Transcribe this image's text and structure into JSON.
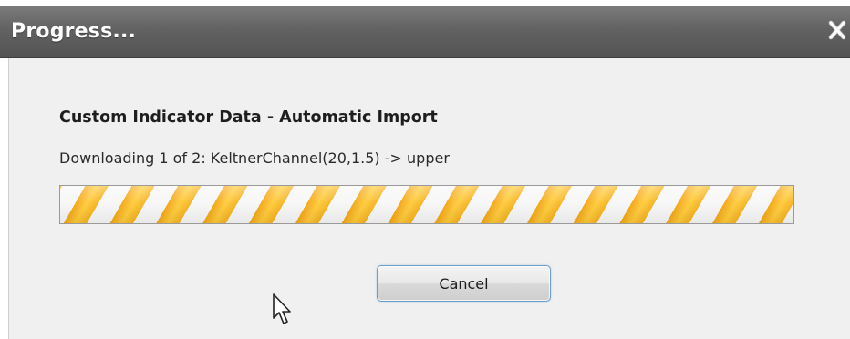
{
  "window": {
    "title": "Progress...",
    "close_icon": "close-icon"
  },
  "dialog": {
    "heading": "Custom Indicator Data - Automatic Import",
    "status": "Downloading 1 of 2: KeltnerChannel(20,1.5) -> upper",
    "progress": {
      "fraction": 1.0,
      "style": "striped-indeterminate"
    },
    "cancel_label": "Cancel"
  },
  "colors": {
    "titlebar": "#626262",
    "client_background": "#f0f0f0",
    "progress_stripe": "#ffcb3a",
    "button_border": "#6e9fc8"
  },
  "icons": {
    "cursor": "mouse-pointer-icon"
  }
}
